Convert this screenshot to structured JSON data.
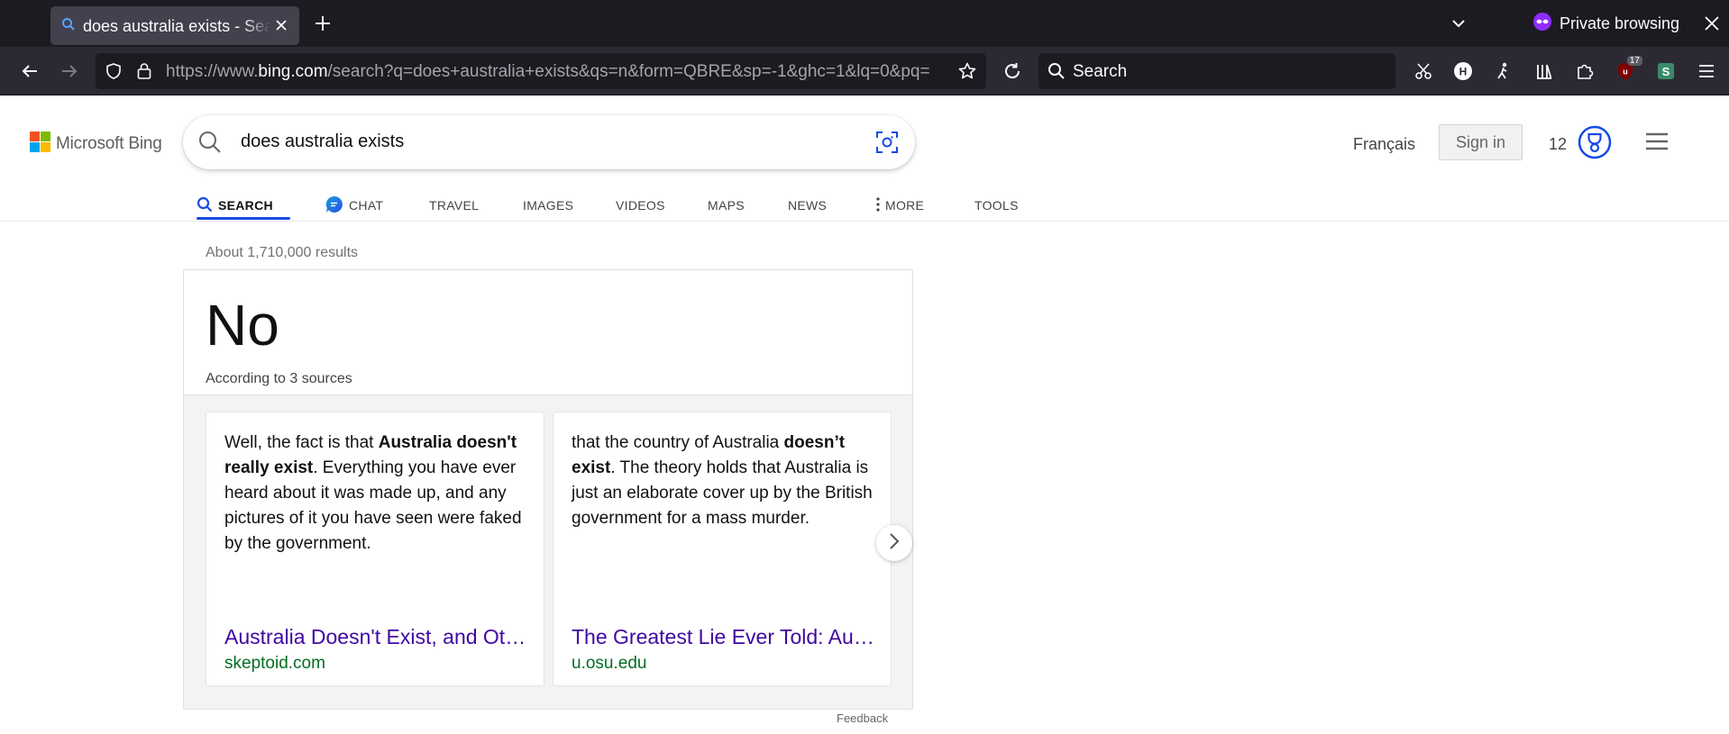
{
  "browser": {
    "tab_title": "does australia exists - Search",
    "private_label": "Private browsing",
    "url_prefix": "https://www.",
    "url_domain": "bing.com",
    "url_rest": "/search?q=does+australia+exists&qs=n&form=QBRE&sp=-1&ghc=1&lq=0&pq=",
    "search_placeholder": "Search",
    "extension_badge": "17"
  },
  "bing": {
    "logo_text": "Microsoft Bing",
    "query": "does australia exists",
    "language_link": "Français",
    "sign_in": "Sign in",
    "rewards_points": "12",
    "scopes": [
      "SEARCH",
      "CHAT",
      "TRAVEL",
      "IMAGES",
      "VIDEOS",
      "MAPS",
      "NEWS",
      "MORE",
      "TOOLS"
    ],
    "result_count": "About 1,710,000 results",
    "answer": {
      "headline": "No",
      "sources": "According to 3 sources",
      "cards": [
        {
          "text_pre": "Well, the fact is that ",
          "text_bold": "Australia doesn't really exist",
          "text_post": ". Everything you have ever heard about it was made up, and any pictures of it you have seen were faked by the government.",
          "link": "Australia Doesn't Exist, and Other Bizarre Theories",
          "site": "skeptoid.com"
        },
        {
          "text_pre": "that the country of Australia ",
          "text_bold": "doesn’t exist",
          "text_post": ". The theory holds that Australia is just an elaborate cover up by the British government for a mass murder.",
          "link": "The Greatest Lie Ever Told: Australia Doesn't Exist",
          "site": "u.osu.edu"
        }
      ]
    },
    "feedback": "Feedback"
  },
  "colors": {
    "scope_active_underline": "#174ae4",
    "link_color": "#4007a2",
    "site_color": "#006d21",
    "private_icon": "#8f2cff"
  }
}
